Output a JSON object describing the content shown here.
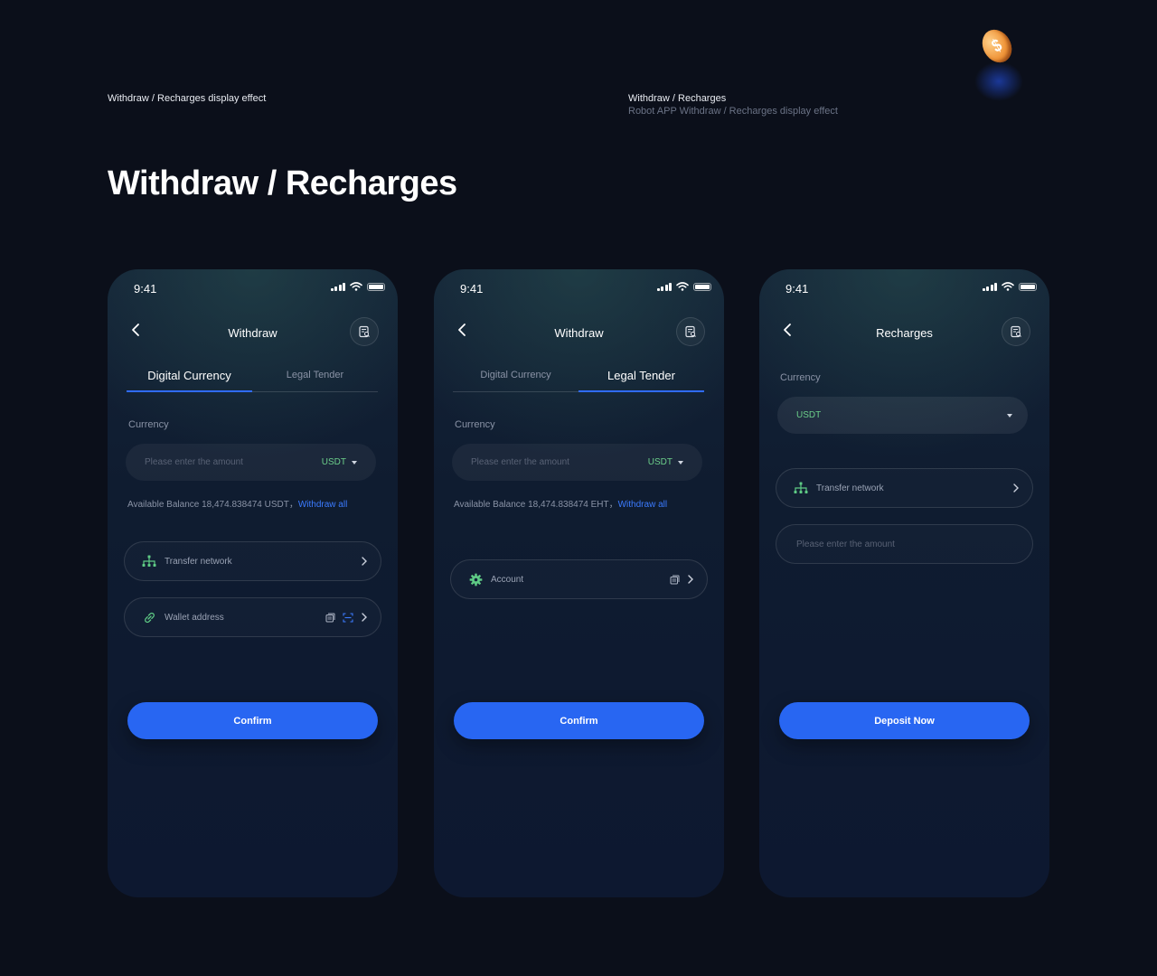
{
  "header": {
    "caption_left": "Withdraw / Recharges display effect",
    "caption_right_title": "Withdraw / Recharges",
    "caption_right_subtitle": "Robot APP Withdraw / Recharges display effect",
    "title": "Withdraw / Recharges",
    "coin_symbol": "$"
  },
  "colors": {
    "background": "#0b0f1a",
    "accent_blue": "#2866f2",
    "link_blue": "#3b7bff",
    "currency_green": "#6ccf8a"
  },
  "screens": [
    {
      "status_time": "9:41",
      "title": "Withdraw",
      "tabs": [
        {
          "label": "Digital Currency",
          "active": true
        },
        {
          "label": "Legal Tender",
          "active": false
        }
      ],
      "currency_label": "Currency",
      "amount_placeholder": "Please enter the amount",
      "coin": "USDT",
      "balance_text": "Available Balance 18,474.838474 USDT，",
      "withdraw_all": "Withdraw all",
      "rows": [
        {
          "icon": "network-icon",
          "label": "Transfer network"
        },
        {
          "icon": "link-icon",
          "label": "Wallet address"
        }
      ],
      "button": "Confirm"
    },
    {
      "status_time": "9:41",
      "title": "Withdraw",
      "tabs": [
        {
          "label": "Digital Currency",
          "active": false
        },
        {
          "label": "Legal Tender",
          "active": true
        }
      ],
      "currency_label": "Currency",
      "amount_placeholder": "Please enter the amount",
      "coin": "USDT",
      "balance_text": "Available Balance 18,474.838474 EHT，",
      "withdraw_all": "Withdraw all",
      "rows": [
        {
          "icon": "gear-icon",
          "label": "Account"
        }
      ],
      "button": "Confirm"
    },
    {
      "status_time": "9:41",
      "title": "Recharges",
      "currency_label": "Currency",
      "selected_coin": "USDT",
      "rows": [
        {
          "icon": "network-icon",
          "label": "Transfer network"
        }
      ],
      "amount_placeholder": "Please enter the amount",
      "button": "Deposit Now"
    }
  ]
}
